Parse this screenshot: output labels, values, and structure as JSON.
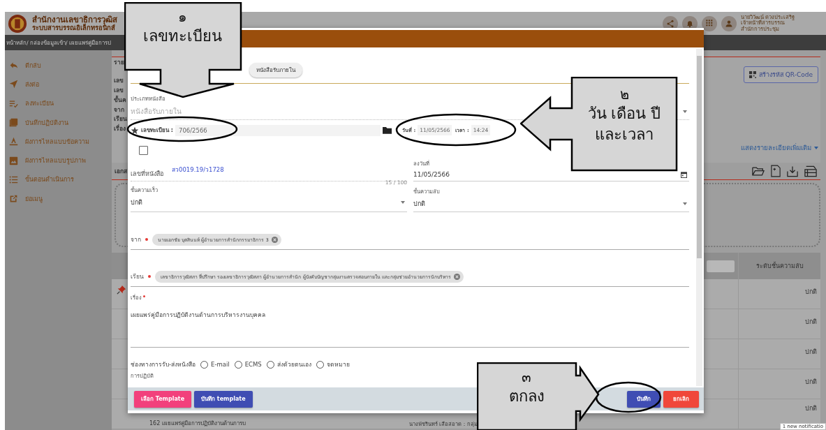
{
  "header": {
    "title": "สำนักงานเลขาธิการวุฒิส",
    "subtitle": "ระบบสารบรรณอิเล็กทรอนิกส์",
    "user_name": "นายวิวัฒน์ ดวงประเสริฐ",
    "user_role": "เจ้าหน้าที่สารบรรณ",
    "user_unit": "สำนักการประชุม"
  },
  "breadcrumb": "หน้าหลัก/ กล่องข้อมูลเข้า/ เผยแพร่คู่มือการป",
  "sidebar": {
    "items": [
      {
        "kind": "reply",
        "label": "ตีกลับ"
      },
      {
        "kind": "send",
        "label": "ส่งต่อ"
      },
      {
        "kind": "register",
        "label": "ลงทะเบียน"
      },
      {
        "kind": "notebook",
        "label": "บันทึกปฏิบัติงาน"
      },
      {
        "kind": "text",
        "label": "ผังการไหลแบบข้อความ"
      },
      {
        "kind": "image",
        "label": "ผังการไหลแบบรูปภาพ"
      },
      {
        "kind": "steps",
        "label": "ขั้นตอนดำเนินการ"
      },
      {
        "kind": "external",
        "label": "ย่อเมนู"
      }
    ]
  },
  "detail": {
    "labels": [
      "ราย",
      "เลข",
      "เลข",
      "ขั้นค",
      "จาก",
      "เรียน",
      "เรื่อง"
    ],
    "qr_button": "สร้างรหัส QR-Code",
    "more_link": "แสดงรายละเอียดเพิ่มเติม",
    "section_label": "เอกส"
  },
  "table": {
    "column_header": "ระดับชั้นความลับ",
    "rows": [
      {
        "pinned": true,
        "level_text": "ปกติ"
      },
      {
        "pinned": false,
        "level_text": "ปกติ"
      },
      {
        "pinned": false,
        "level_text": "ปกติ"
      },
      {
        "pinned": false,
        "level_text": "ปกติ"
      },
      {
        "pinned": false,
        "level_text": "ปกติ",
        "subject": "162 เผยแพร่คู่มือการปฏิบัติงานด้านการบ",
        "sender": "นางพัชรินทร์ เสือสอาด : กลุ่ม"
      }
    ]
  },
  "notification": "1 new notificatio",
  "dialog": {
    "chip": "หนังสือรับภายใน",
    "doc_type": {
      "label": "ประเภทหนังสือ",
      "placeholder": "หนังสือรับภายใน"
    },
    "registry": {
      "label": "เลขทะเบียน :",
      "value": "706/2566",
      "date_label": "วันที่ :",
      "date": "11/05/2566",
      "time_label": "เวลา :",
      "time": "14:24"
    },
    "secret_checkbox": {
      "checked": false
    },
    "doc_number": {
      "label": "เลขที่หนังสือ",
      "value": "สว0019.19/ว1728",
      "counter": "15 / 100"
    },
    "doc_date": {
      "label": "ลงวันที่",
      "value": "11/05/2566"
    },
    "speed": {
      "label": "ชั้นความเร็ว",
      "value": "ปกติ"
    },
    "secrecy": {
      "label": "ชั้นความลับ",
      "value": "ปกติ"
    },
    "from": {
      "label": "จาก",
      "required": true,
      "chip": "นายเอกชัย บุตสินนท์ ผู้อำนวยการสำนักกรรมาธิการ 3"
    },
    "to": {
      "label": "เรียน",
      "required": true,
      "chip": "เลขาธิการวุฒิสภา ที่ปรึกษา รองเลขาธิการวุฒิสภา ผู้อำนวยการสำนัก ผู้บังคับบัญชากลุ่มงานตรวจสอบภายใน และกลุ่มช่วยอำนวยการนักบริหาร"
    },
    "subject": {
      "label": "เรื่อง",
      "required": true,
      "value": "เผยแพร่คู่มือการปฏิบัติงานด้านการบริหารงานบุคคล"
    },
    "channel": {
      "label": "ช่องทางการรับ-ส่งหนังสือ",
      "options": [
        {
          "label": "E-mail",
          "selected": false
        },
        {
          "label": "ECMS",
          "selected": false
        },
        {
          "label": "ส่งด้วยตนเอง",
          "selected": false
        },
        {
          "label": "จดหมาย",
          "selected": false
        }
      ]
    },
    "action_label": "การปฏิบัติ",
    "buttons": [
      {
        "kind": "template",
        "label": "เลือก Template"
      },
      {
        "kind": "primary",
        "label": "บันทึก template"
      },
      {
        "kind": "primary",
        "label": "บันทึก"
      },
      {
        "kind": "danger",
        "label": "ยกเลิก"
      }
    ]
  },
  "callouts": [
    {
      "kind": "down",
      "number": "๑",
      "lines": [
        "เลขทะเบียน"
      ]
    },
    {
      "kind": "left",
      "number": "๒",
      "lines": [
        "วัน เดือน ปี",
        "และเวลา"
      ]
    },
    {
      "kind": "right",
      "number": "๓",
      "lines": [
        "ตกลง"
      ]
    }
  ]
}
